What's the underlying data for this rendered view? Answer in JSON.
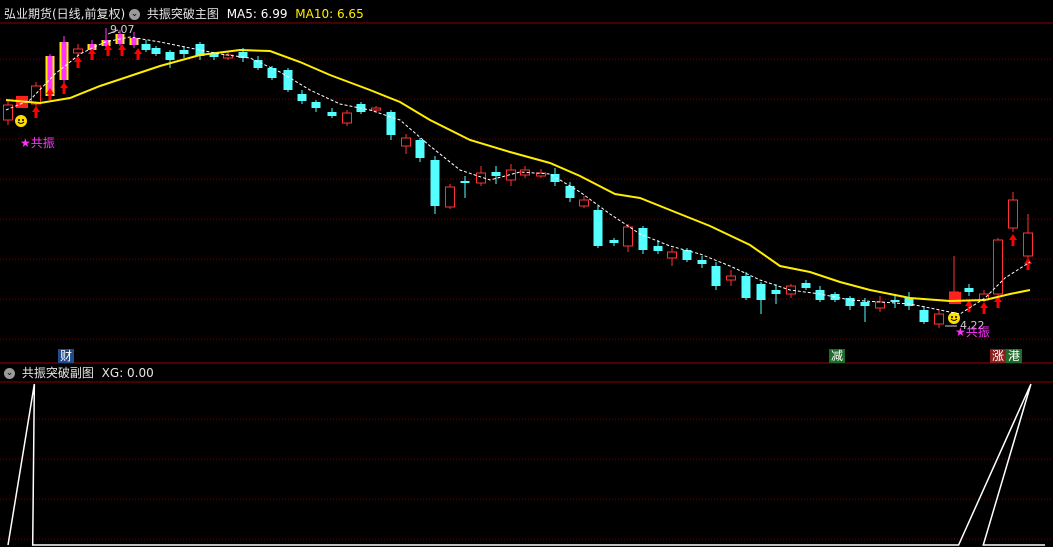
{
  "header": {
    "instrument": "弘业期货(日线,前复权)",
    "main_indicator": "共振突破主图",
    "ma5_label": "MA5: 6.99",
    "ma10_label": "MA10: 6.65"
  },
  "sub_header": {
    "indicator": "共振突破副图",
    "xg_label": "XG: 0.00"
  },
  "annotations": {
    "high_label": "9.07",
    "low_label": "4.22",
    "signal_left": "★共振",
    "signal_right": "★共振",
    "tag_cai": "财",
    "tag_jian": "减",
    "tag_zhang": "涨",
    "tag_gang": "港"
  },
  "colors": {
    "background": "#000000",
    "up_candle": "#ff3333",
    "down_candle": "#55ffff",
    "ma10_line": "#ffee00",
    "ma5_line": "#ffffff",
    "grid": "#7a0000",
    "signal_bar_pink": "#ff33ff",
    "signal_bar_yellow": "#ffee00",
    "arrow": "#ff0000",
    "xg_line": "#ffffff"
  },
  "chart_data": [
    {
      "type": "candlestick",
      "title": "共振突破主图",
      "series": [
        {
          "name": "MA5",
          "line_style": "dashed"
        },
        {
          "name": "MA10",
          "line_style": "solid"
        }
      ]
    },
    {
      "type": "line",
      "title": "共振突破副图",
      "series": [
        {
          "name": "XG",
          "values": [
            0,
            1,
            0,
            0,
            0,
            0,
            0,
            0,
            0,
            0,
            0,
            0,
            0,
            0,
            0,
            0,
            0,
            0,
            0,
            0,
            0,
            0,
            0,
            0,
            0,
            0,
            0,
            0,
            0,
            0,
            0,
            0,
            0,
            0,
            0,
            0,
            0,
            0,
            0,
            0,
            0,
            0,
            0,
            0,
            0,
            0,
            0,
            0,
            0,
            0,
            0,
            0,
            0,
            0,
            0,
            0,
            0,
            0,
            0,
            0,
            0,
            0,
            0,
            0,
            0,
            0,
            0,
            0,
            0,
            0,
            0,
            0,
            0,
            0,
            0,
            0,
            0,
            0,
            1,
            0,
            0,
            0,
            0,
            0,
            0
          ]
        }
      ]
    }
  ]
}
